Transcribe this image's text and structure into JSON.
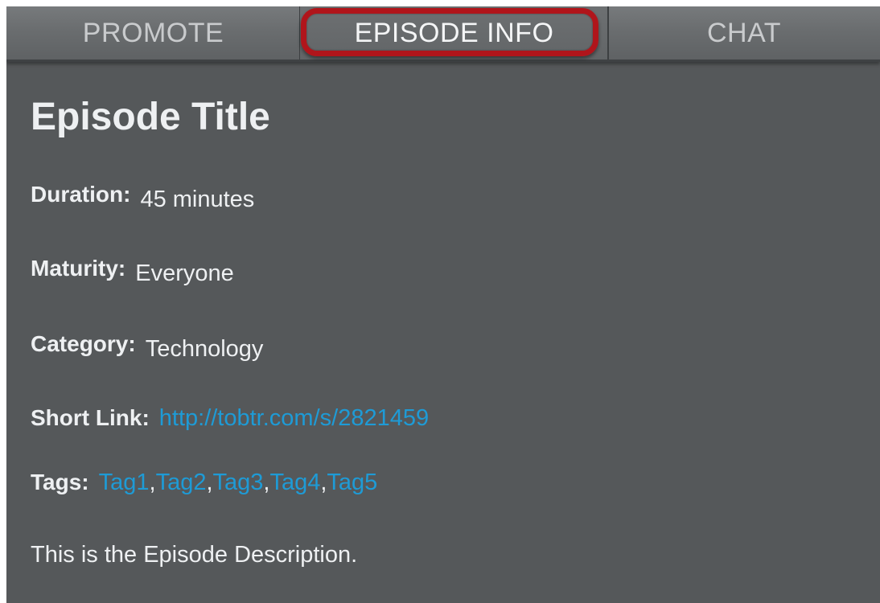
{
  "tabs": {
    "promote": "PROMOTE",
    "episode_info": "EPISODE INFO",
    "chat": "CHAT",
    "active": "episode_info"
  },
  "episode": {
    "title": "Episode Title",
    "duration_label": "Duration:",
    "duration_value": "45 minutes",
    "maturity_label": "Maturity:",
    "maturity_value": "Everyone",
    "category_label": "Category:",
    "category_value": "Technology",
    "short_link_label": "Short Link:",
    "short_link_value": "http://tobtr.com/s/2821459",
    "tags_label": "Tags:",
    "tags": [
      "Tag1",
      "Tag2",
      "Tag3",
      "Tag4",
      "Tag5"
    ],
    "description": "This is the Episode Description."
  },
  "colors": {
    "panel_background": "#55585a",
    "tab_bar": "#6a6d6f",
    "link": "#1e9bd6",
    "highlight_outline": "#b0151b",
    "text": "#eef0f2"
  }
}
